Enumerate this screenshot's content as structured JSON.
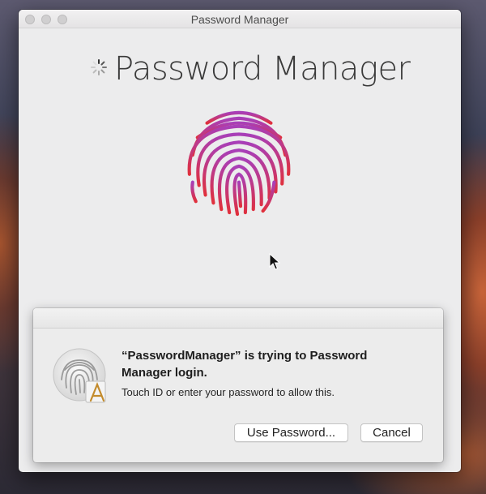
{
  "window": {
    "title": "Password Manager"
  },
  "app": {
    "name": "Password Manager"
  },
  "dialog": {
    "title": "“PasswordManager” is trying to Password Manager login.",
    "message": "Touch ID or enter your password to allow this.",
    "buttons": {
      "use_password": "Use Password...",
      "cancel": "Cancel"
    }
  },
  "colors": {
    "fingerprint_top": "#a83fb8",
    "fingerprint_bottom": "#e0303c",
    "window_bg": "#ececed"
  }
}
